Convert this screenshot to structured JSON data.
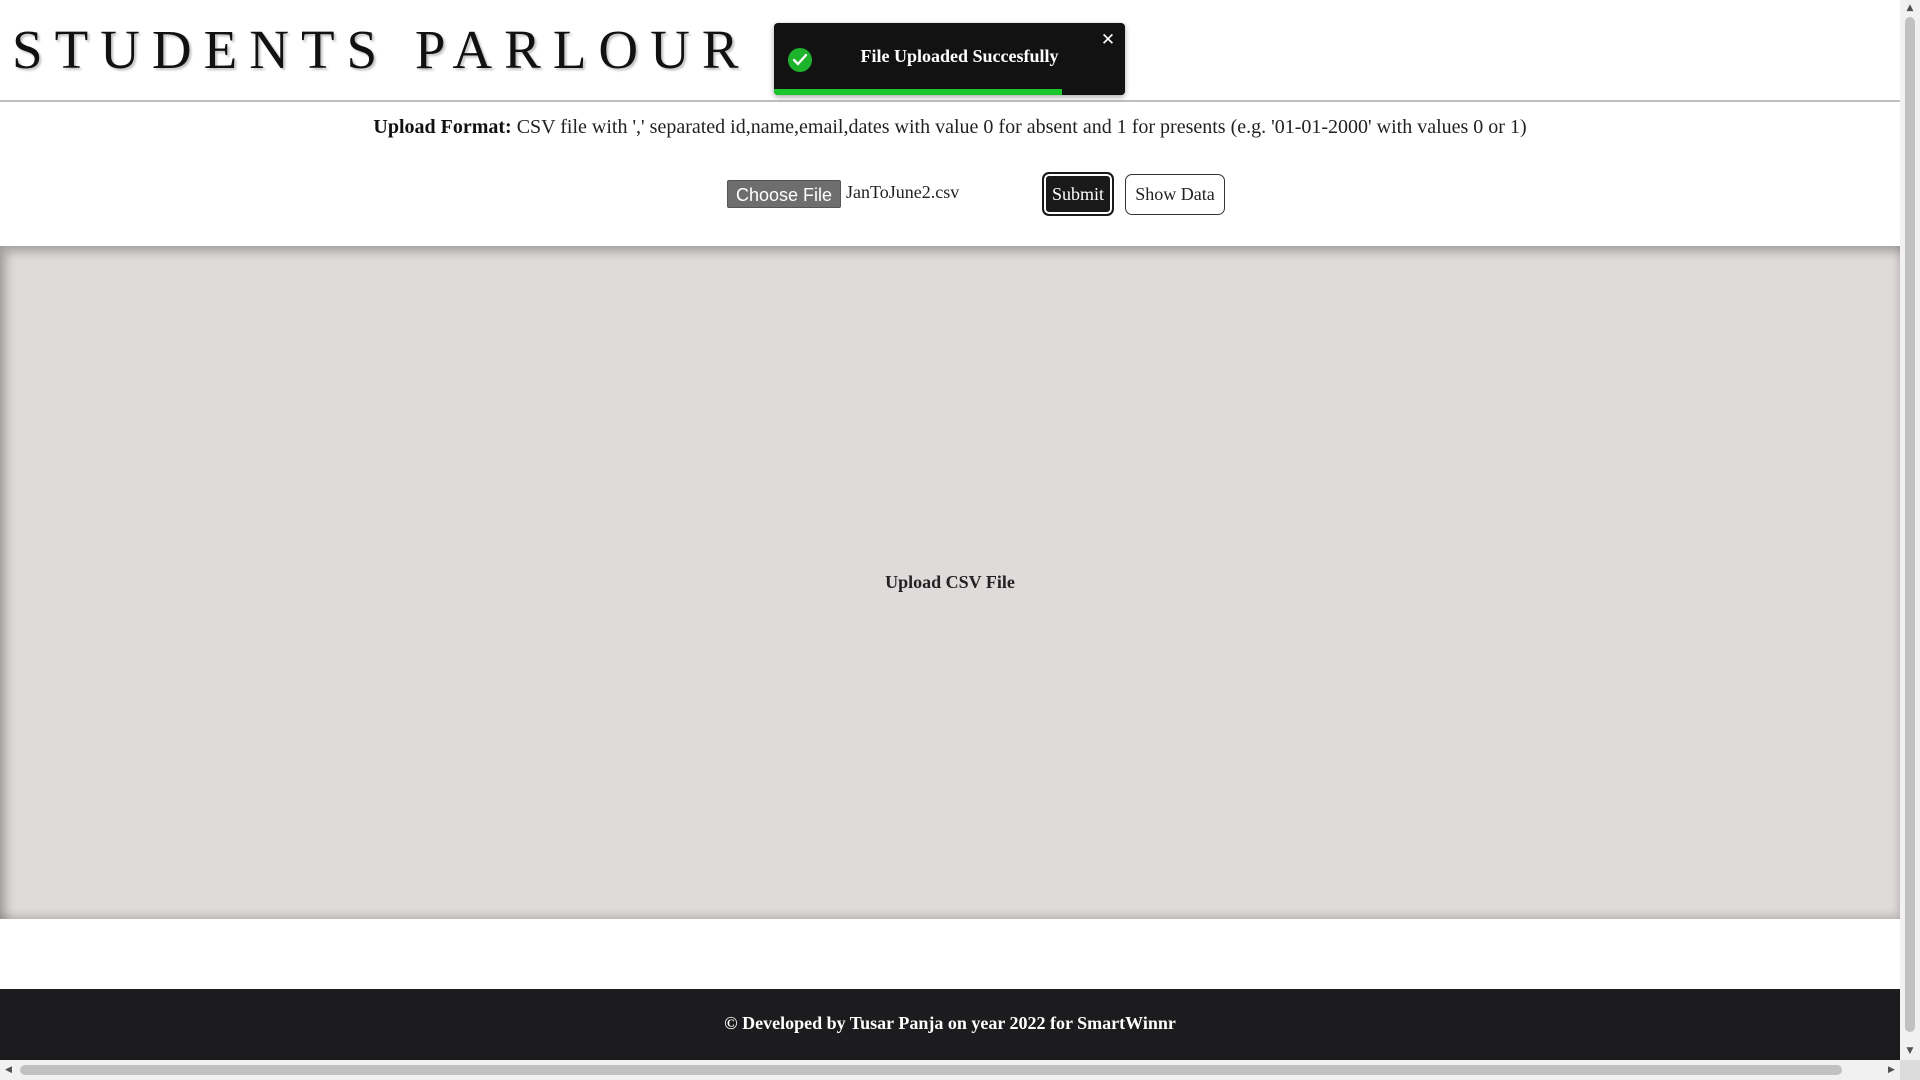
{
  "header": {
    "title": "STUDENTS PARLOUR"
  },
  "toast": {
    "message": "File Uploaded Succesfully",
    "close_glyph": "✕",
    "icon": "check-circle-icon",
    "progress_fraction": 0.82,
    "progress_color": "#19c72c"
  },
  "upload": {
    "format_label": "Upload Format:",
    "format_text": " CSV file with ',' separated id,name,email,dates with value 0 for absent and 1 for presents (e.g. '01-01-2000' with values 0 or 1)",
    "choose_file_label": "Choose File",
    "file_name": "JanToJune2.csv",
    "submit_label": "Submit",
    "show_data_label": "Show Data"
  },
  "panel": {
    "label": "Upload CSV File"
  },
  "footer": {
    "text": "© Developed by Tusar Panja on year 2022 for SmartWinnr"
  },
  "scrollbars": {
    "up_glyph": "▲",
    "down_glyph": "▼",
    "left_glyph": "◀",
    "right_glyph": "▶"
  }
}
